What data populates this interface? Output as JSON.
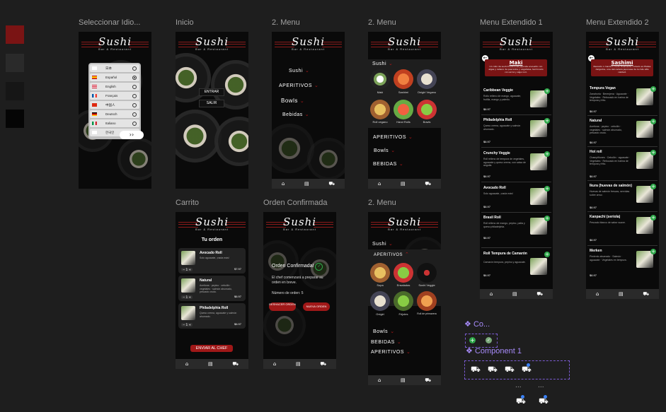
{
  "swatches": [
    "#7a1414",
    "#2a2a2a",
    "#161616",
    "#050505"
  ],
  "frames": {
    "idioma": {
      "label": "Seleccionar Idio..."
    },
    "inicio": {
      "label": "Inicio",
      "enter": "ENTRAR",
      "exit": "SALIR"
    },
    "menu1": {
      "label": "2. Menu",
      "items": [
        "Sushi",
        "APERITIVOS",
        "Bowls",
        "Bebidas"
      ]
    },
    "menu2": {
      "label": "2. Menu",
      "items": [
        "APERITIVOS",
        "Bowls",
        "BEBIDAS"
      ]
    },
    "menu3": {
      "label": "2. Menu",
      "top": "Sushi",
      "items": [
        "Bowls",
        "BEBIDAS",
        "APERITIVOS"
      ]
    },
    "ext1": {
      "label": "Menu Extendido 1"
    },
    "ext2": {
      "label": "Menu Extendido 2"
    },
    "carrito": {
      "label": "Carrito"
    },
    "orden": {
      "label": "Orden Confirmada"
    }
  },
  "brand": {
    "name": "Sushi",
    "tagline": "Bar & Restaurant"
  },
  "languages": [
    {
      "name": "日本",
      "flag": "#fff",
      "selected": false
    },
    {
      "name": "Español",
      "flag": "#c60b1e",
      "selected": true
    },
    {
      "name": "English",
      "flag": "#cf142b",
      "selected": false
    },
    {
      "name": "Français",
      "flag": "#0055a4",
      "selected": false
    },
    {
      "name": "中国人",
      "flag": "#de2910",
      "selected": false
    },
    {
      "name": "Deutsch",
      "flag": "#000",
      "selected": false
    },
    {
      "name": "Italiano",
      "flag": "#009246",
      "selected": false
    },
    {
      "name": "한국인",
      "flag": "#fff",
      "selected": false
    }
  ],
  "lang_next": "››",
  "sushi_grid": [
    {
      "name": "Maki"
    },
    {
      "name": "Sashimi"
    },
    {
      "name": "Onigiri Vegano"
    },
    {
      "name": "Roll vegano"
    },
    {
      "name": "Hand Rolls"
    },
    {
      "name": "Bowls"
    }
  ],
  "aperitivos_grid": [
    {
      "name": "Sopa"
    },
    {
      "name": "Ensaladas"
    },
    {
      "name": "Sushi Veggie"
    },
    {
      "name": "Onigiri"
    },
    {
      "name": "Frijoles"
    },
    {
      "name": "Roll de primavera"
    }
  ],
  "ext1": {
    "title": "Maki",
    "desc": "Un rollo de sushi tradicional japonés envuelto con algas y relleno de pescados y vegetales, terminado con arroz y alga nori.",
    "items": [
      {
        "name": "Caribbean Veggie",
        "desc": "Rollo relleno de mango, aguacate, frutilla, mango y palmito.",
        "price": "$6.97"
      },
      {
        "name": "Philadelphia Roll",
        "desc": "Queso crema, aguacate y salmón ahumado.",
        "price": "$6.97"
      },
      {
        "name": "Crunchy Veggie",
        "desc": "Roll relleno de tempura de vegetales, aguacate y queso crema, con salsa de anguila.",
        "price": "$6.97"
      },
      {
        "name": "Avocado Roll",
        "desc": "Solo aguacate, ¡nada más!",
        "price": "$6.97"
      },
      {
        "name": "Brasil Roll",
        "desc": "Roll relleno de mango, pepino, palta y queso philadelphia.",
        "price": "$6.97"
      },
      {
        "name": "Roll Tempura de Camarón",
        "desc": "Camarón tempura, pepino y aguacate.",
        "price": "$6.97"
      }
    ]
  },
  "ext2": {
    "title": "Sashimi",
    "desc": "Pescado o marisco crudo finamente cortado en filetes delgados, una delicadeza japonesa de la más alta calidad.",
    "items": [
      {
        "name": "Tempura Vegan",
        "desc": "Zanahoria · Berenjena · Aguacate · Vegetales · Rebozado en harina de tempura y frito.",
        "price": "$6.97"
      },
      {
        "name": "Natural",
        "desc": "Aceituna · pepino · cebollín · vegetales · salmón ahumado, pescado crudo.",
        "price": "$6.97"
      },
      {
        "name": "Hot roll",
        "desc": "Champiñones · Cebollín · aguacate · Vegetales · Rebozado en harina de tempura y frito.",
        "price": "$6.97"
      },
      {
        "name": "Ikura (huevas de salmón)",
        "desc": "Huevas de salmón frescas, servidas sobre arroz.",
        "price": "$6.97"
      },
      {
        "name": "Kanpachi (seriola)",
        "desc": "Pescado blanco de sabor suave.",
        "price": "$6.97"
      },
      {
        "name": "Merken",
        "desc": "Pimiento ahumado · Salmón · aguacate · Vegetales en tempura.",
        "price": "$6.97"
      }
    ]
  },
  "carrito": {
    "title": "Tu orden",
    "items": [
      {
        "name": "Avocado Roll",
        "desc": "Solo aguacate, ¡nada más!",
        "price": "$7.97",
        "qty": "1"
      },
      {
        "name": "Natural",
        "desc": "Aceituna · pepino · cebollín · vegetales · salmón ahumado, pescado crudo.",
        "price": "$6.97",
        "qty": "1"
      },
      {
        "name": "Philadelphia Roll",
        "desc": "Queso crema, aguacate y salmón ahumado.",
        "price": "$6.97",
        "qty": "1"
      }
    ],
    "button": "ENVIAR AL CHEF"
  },
  "orden": {
    "title": "Orden Confirmada!",
    "msg": "El chef comenzará a preparar su orden en breve.",
    "num": "Número de orden: 5",
    "btn1": "DESHACER ORDEN",
    "btn2": "NUEVA ORDEN"
  },
  "components": {
    "label_short": "Co...",
    "label": "Component 1",
    "more": "..."
  }
}
